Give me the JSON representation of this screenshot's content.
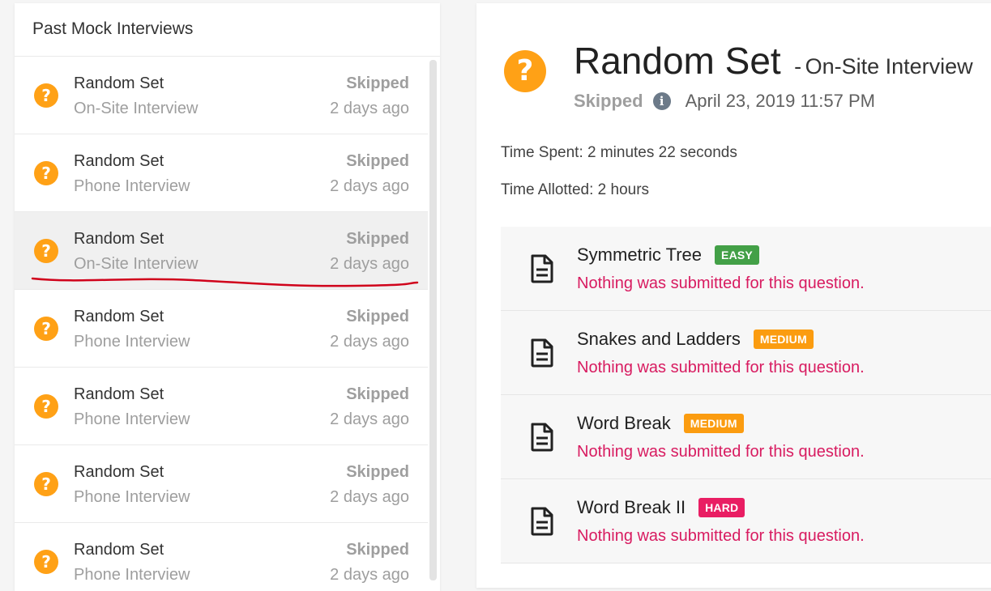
{
  "left_panel": {
    "title": "Past Mock Interviews",
    "items": [
      {
        "title": "Random Set",
        "subtitle": "On-Site Interview",
        "status": "Skipped",
        "time": "2 days ago",
        "icon": "question-icon"
      },
      {
        "title": "Random Set",
        "subtitle": "Phone Interview",
        "status": "Skipped",
        "time": "2 days ago",
        "icon": "question-icon"
      },
      {
        "title": "Random Set",
        "subtitle": "On-Site Interview",
        "status": "Skipped",
        "time": "2 days ago",
        "icon": "question-icon",
        "selected": true
      },
      {
        "title": "Random Set",
        "subtitle": "Phone Interview",
        "status": "Skipped",
        "time": "2 days ago",
        "icon": "question-icon"
      },
      {
        "title": "Random Set",
        "subtitle": "Phone Interview",
        "status": "Skipped",
        "time": "2 days ago",
        "icon": "question-icon"
      },
      {
        "title": "Random Set",
        "subtitle": "Phone Interview",
        "status": "Skipped",
        "time": "2 days ago",
        "icon": "question-icon"
      },
      {
        "title": "Random Set",
        "subtitle": "Phone Interview",
        "status": "Skipped",
        "time": "2 days ago",
        "icon": "question-icon"
      }
    ]
  },
  "detail": {
    "title": "Random Set",
    "separator": "-",
    "subtitle": "On-Site Interview",
    "status": "Skipped",
    "date": "April 23, 2019 11:57 PM",
    "time_spent": "Time Spent: 2 minutes 22 seconds",
    "time_allotted": "Time Allotted: 2 hours",
    "questions": [
      {
        "title": "Symmetric Tree",
        "difficulty": "EASY",
        "color": "#43a047",
        "message": "Nothing was submitted for this question."
      },
      {
        "title": "Snakes and Ladders",
        "difficulty": "MEDIUM",
        "color": "#fb9c10",
        "message": "Nothing was submitted for this question."
      },
      {
        "title": "Word Break",
        "difficulty": "MEDIUM",
        "color": "#fb9c10",
        "message": "Nothing was submitted for this question."
      },
      {
        "title": "Word Break II",
        "difficulty": "HARD",
        "color": "#e91e63",
        "message": "Nothing was submitted for this question."
      }
    ]
  },
  "colors": {
    "accent_orange": "#ffa116",
    "error_pink": "#d81b60",
    "annotation_red": "#d0021b"
  }
}
